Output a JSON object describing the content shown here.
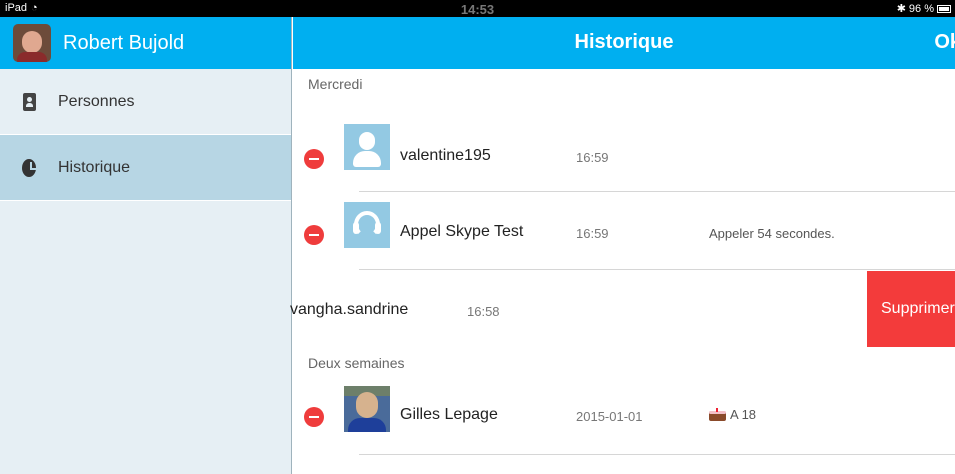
{
  "status_bar": {
    "device": "iPad",
    "time": "14:53",
    "battery": "96 %"
  },
  "sidebar": {
    "user_name": "Robert  Bujold",
    "items": [
      {
        "label": "Personnes",
        "icon": "contacts-icon",
        "active": false
      },
      {
        "label": "Historique",
        "icon": "clock-icon",
        "active": true
      }
    ]
  },
  "header": {
    "title": "Historique",
    "right_button": "Ok"
  },
  "sections": [
    {
      "label": "Mercredi",
      "rows": [
        {
          "name": "valentine195",
          "time": "16:59",
          "detail": "",
          "avatar": "default-contact"
        },
        {
          "name": "Appel Skype Test",
          "time": "16:59",
          "detail": "Appeler 54 secondes.",
          "avatar": "headset"
        },
        {
          "name": "vangha.sandrine",
          "time": "16:58",
          "detail": "",
          "avatar": "none",
          "swiped": true,
          "delete_label": "Supprimer"
        }
      ]
    },
    {
      "label": "Deux semaines",
      "rows": [
        {
          "name": "Gilles Lepage",
          "time": "2015-01-01",
          "detail": "A 18",
          "avatar": "photo",
          "detail_icon": "birthday-cake-icon"
        }
      ]
    }
  ],
  "colors": {
    "accent": "#00aff0",
    "delete": "#f33b3b",
    "sidebar_bg": "#e6eff4",
    "sidebar_active": "#b7d6e4"
  }
}
